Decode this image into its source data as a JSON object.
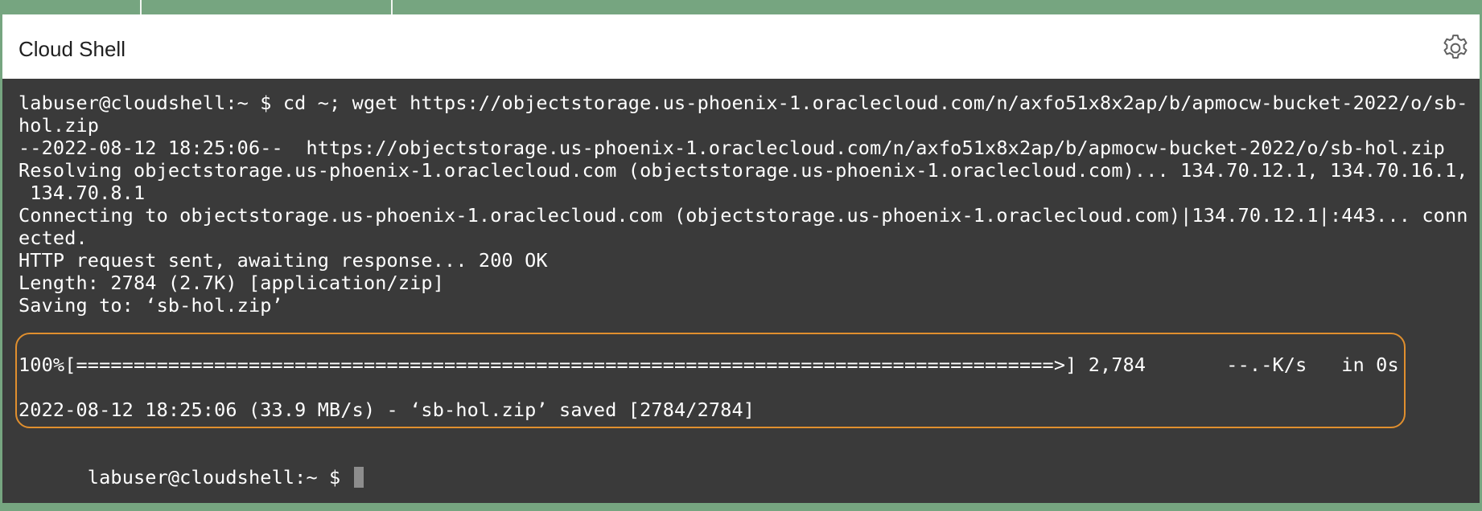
{
  "window": {
    "title": "Cloud Shell"
  },
  "icons": {
    "settings": "gear-icon"
  },
  "colors": {
    "background": "#76a580",
    "header_bg": "#ffffff",
    "terminal_bg": "#3a3a3a",
    "terminal_text": "#ffffff",
    "highlight": "#e08f2e"
  },
  "terminal": {
    "lines": [
      "labuser@cloudshell:~ $ cd ~; wget https://objectstorage.us-phoenix-1.oraclecloud.com/n/axfo51x8x2ap/b/apmocw-bucket-2022/o/sb-",
      "hol.zip",
      "--2022-08-12 18:25:06--  https://objectstorage.us-phoenix-1.oraclecloud.com/n/axfo51x8x2ap/b/apmocw-bucket-2022/o/sb-hol.zip",
      "Resolving objectstorage.us-phoenix-1.oraclecloud.com (objectstorage.us-phoenix-1.oraclecloud.com)... 134.70.12.1, 134.70.16.1,",
      " 134.70.8.1",
      "Connecting to objectstorage.us-phoenix-1.oraclecloud.com (objectstorage.us-phoenix-1.oraclecloud.com)|134.70.12.1|:443... conn",
      "ected.",
      "HTTP request sent, awaiting response... 200 OK",
      "Length: 2784 (2.7K) [application/zip]",
      "Saving to: ‘sb-hol.zip’"
    ],
    "progress_line": "100%[=====================================================================================>] 2,784       --.-K/s   in 0s",
    "saved_line": "2022-08-12 18:25:06 (33.9 MB/s) - ‘sb-hol.zip’ saved [2784/2784]",
    "prompt": "labuser@cloudshell:~ $ "
  }
}
